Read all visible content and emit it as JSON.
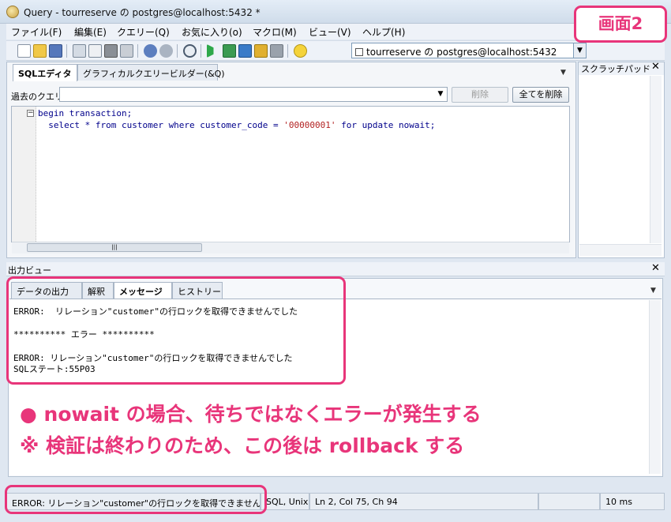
{
  "window": {
    "title": "Query - tourreserve の postgres@localhost:5432 *",
    "screen_badge": "画面2"
  },
  "menu": [
    "ファイル(F)",
    "編集(E)",
    "クエリー(Q)",
    "お気に入り(o)",
    "マクロ(M)",
    "ビュー(V)",
    "ヘルプ(H)"
  ],
  "toolbar": {
    "connection_label": "tourreserve の postgres@localhost:5432",
    "icons": [
      "new-file-icon",
      "open-folder-icon",
      "save-icon",
      "cut-icon",
      "copy-icon",
      "paste-icon",
      "eraser-icon",
      "undo-icon",
      "redo-icon",
      "find-icon",
      "execute-icon",
      "execute-pgscript-icon",
      "execute-to-file-icon",
      "explain-icon",
      "cancel-query-icon",
      "help-icon"
    ]
  },
  "editor": {
    "tabs": [
      "SQLエディタ",
      "グラフィカルクエリービルダー(&Q)"
    ],
    "history_label": "過去のクエリ",
    "delete_label": "削除",
    "delete_all_label": "全てを削除",
    "code_lines": [
      "begin transaction;",
      "select * from customer where customer_code = '00000001' for update nowait;"
    ]
  },
  "scratch_pad": {
    "title": "スクラッチパッド"
  },
  "output": {
    "title": "出力ビュー",
    "tabs": [
      "データの出力",
      "解釈",
      "メッセージ",
      "ヒストリー"
    ],
    "active_tab": "メッセージ",
    "messages": [
      "ERROR:  リレーション\"customer\"の行ロックを取得できませんでした",
      "",
      "********** エラー **********",
      "",
      "ERROR: リレーション\"customer\"の行ロックを取得できませんでした",
      "SQLステート:55P03"
    ]
  },
  "annotations": [
    "● nowait の場合、待ちではなくエラーが発生する",
    "※ 検証は終わりのため、この後は rollback する"
  ],
  "status": {
    "message": "ERROR: リレーション\"customer\"の行ロックを取得できませんでした",
    "encoding": "SQL, Unix",
    "position": "Ln 2, Col 75, Ch 94",
    "duration": "10 ms"
  },
  "colors": {
    "annotation": "#e8357a",
    "sql_keyword": "#00008b",
    "sql_string": "#b22222"
  }
}
